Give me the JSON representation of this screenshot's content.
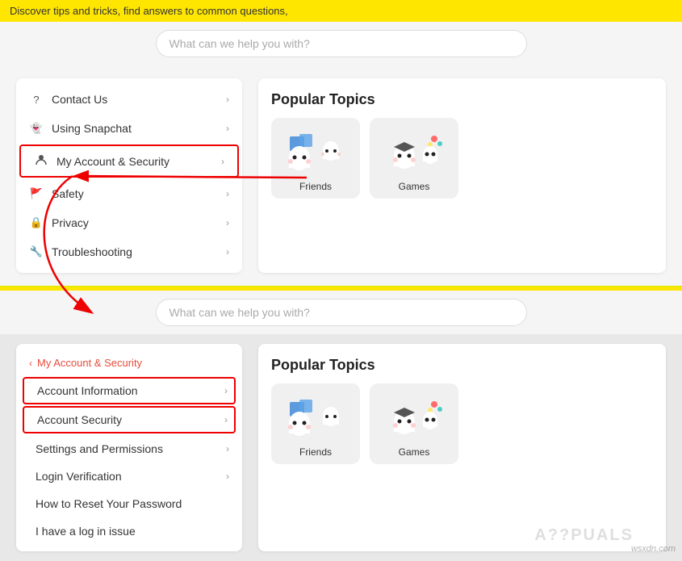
{
  "topBanner": {
    "text": "Discover tips and tricks, find answers to common questions,"
  },
  "searchBar": {
    "placeholder": "What can we help you with?"
  },
  "topMenu": {
    "items": [
      {
        "id": "contact-us",
        "icon": "?",
        "label": "Contact Us",
        "hasChevron": true
      },
      {
        "id": "using-snapchat",
        "icon": "👻",
        "label": "Using Snapchat",
        "hasChevron": true
      },
      {
        "id": "my-account-security",
        "icon": "👤",
        "label": "My Account & Security",
        "hasChevron": true,
        "highlighted": true
      },
      {
        "id": "safety",
        "icon": "🚩",
        "label": "Safety",
        "hasChevron": true
      },
      {
        "id": "privacy",
        "icon": "🔒",
        "label": "Privacy",
        "hasChevron": true
      },
      {
        "id": "troubleshooting",
        "icon": "🔧",
        "label": "Troubleshooting",
        "hasChevron": true
      }
    ]
  },
  "popularTopics": {
    "title": "Popular Topics",
    "items": [
      {
        "id": "friends",
        "label": "Friends"
      },
      {
        "id": "games",
        "label": "Games"
      }
    ]
  },
  "bottomMenu": {
    "breadcrumb": "My Account & Security",
    "items": [
      {
        "id": "account-information",
        "label": "Account Information",
        "hasChevron": true,
        "highlighted": true
      },
      {
        "id": "account-security",
        "label": "Account Security",
        "hasChevron": true,
        "highlighted": true
      },
      {
        "id": "settings-permissions",
        "label": "Settings and Permissions",
        "hasChevron": true
      },
      {
        "id": "login-verification",
        "label": "Login Verification",
        "hasChevron": true
      },
      {
        "id": "reset-password",
        "label": "How to Reset Your Password",
        "hasChevron": false
      },
      {
        "id": "log-issue",
        "label": "I have a log in issue",
        "hasChevron": false
      }
    ]
  },
  "watermark": {
    "text": "wsxdn.com",
    "appuals": "A??PUALS"
  }
}
